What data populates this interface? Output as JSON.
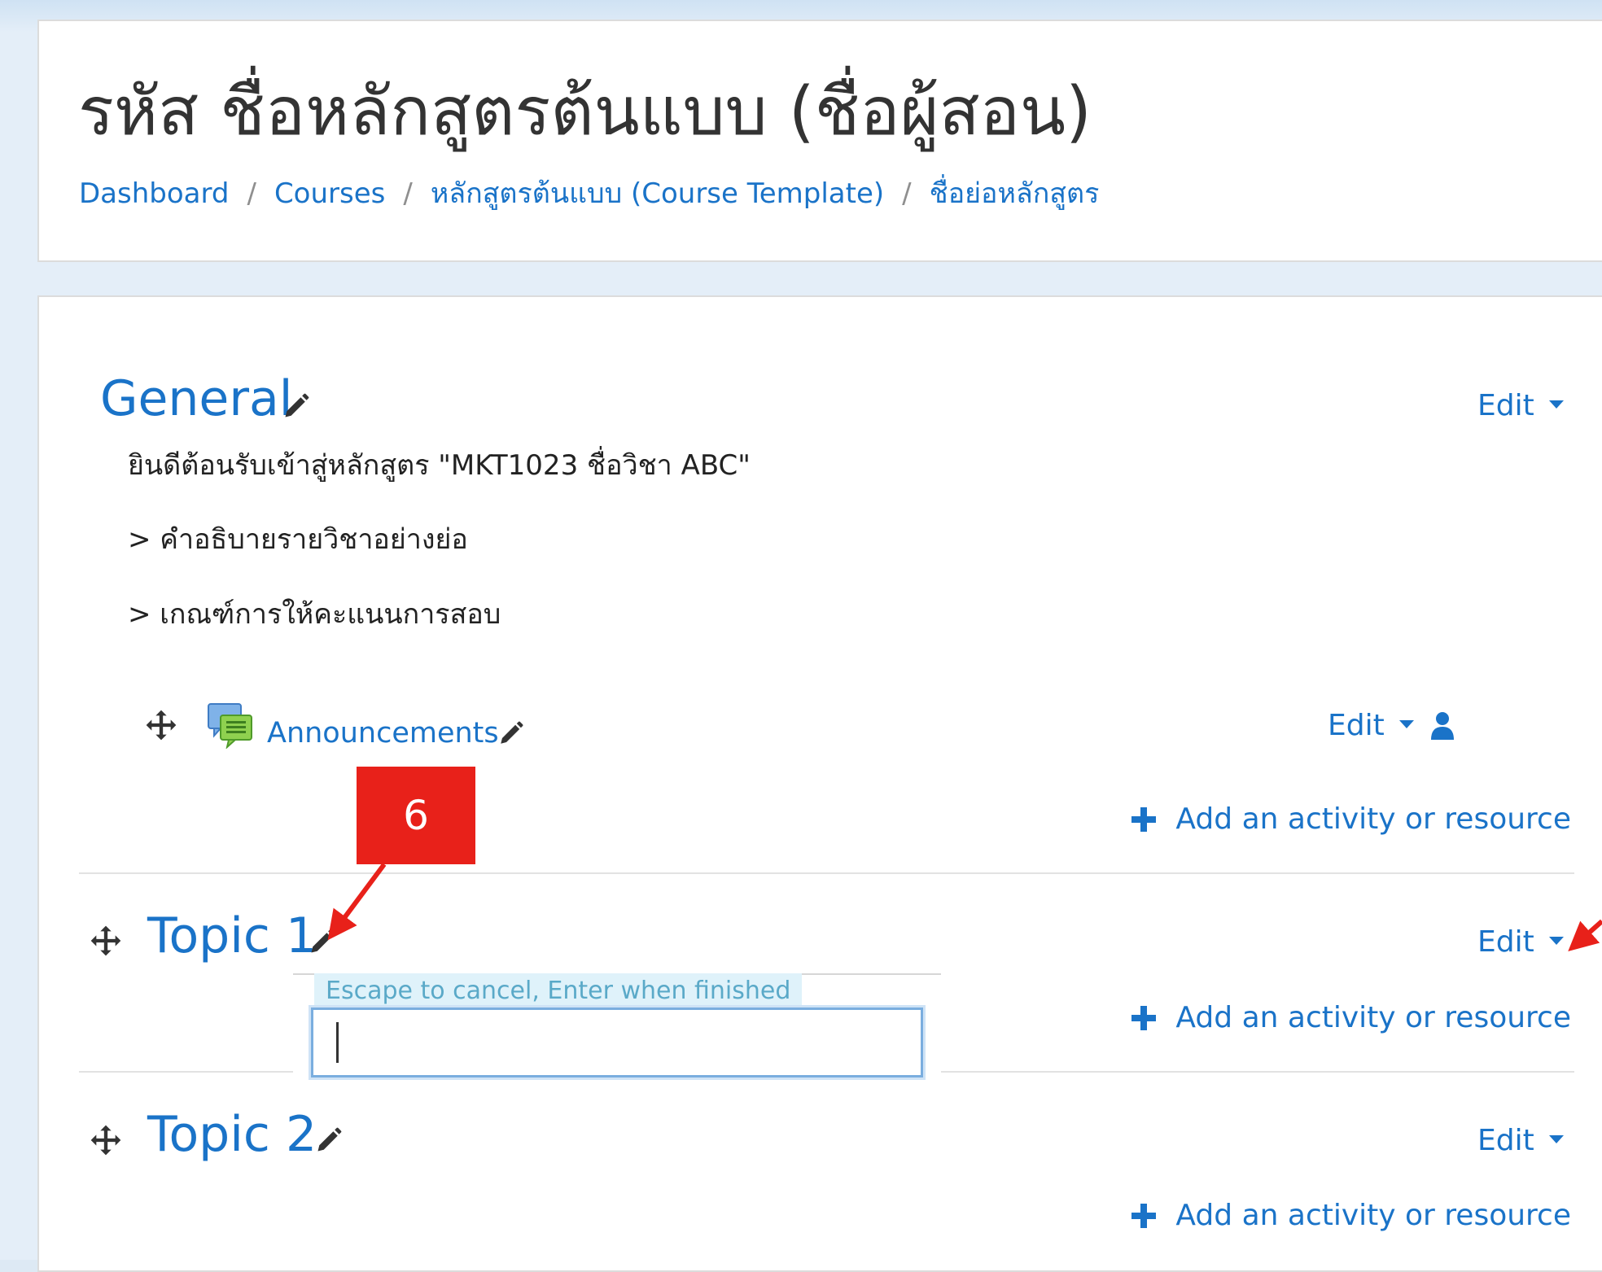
{
  "page": {
    "title": "รหัส ชื่อหลักสูตรต้นแบบ (ชื่อผู้สอน)"
  },
  "breadcrumb": {
    "items": [
      {
        "label": "Dashboard"
      },
      {
        "label": "Courses"
      },
      {
        "label": "หลักสูตรต้นแบบ (Course Template)"
      },
      {
        "label": "ชื่อย่อหลักสูตร"
      }
    ],
    "separator": "/"
  },
  "sections": [
    {
      "title": "General",
      "edit_label": "Edit",
      "summary": [
        "ยินดีต้อนรับเข้าสู่หลักสูตร \"MKT1023 ชื่อวิชา ABC\"",
        "> คำอธิบายรายวิชาอย่างย่อ",
        "> เกณฑ์การให้คะแนนการสอบ"
      ],
      "activities": [
        {
          "name": "Announcements",
          "icon": "forum-icon",
          "edit_label": "Edit"
        }
      ],
      "add_activity_label": "Add an activity or resource"
    },
    {
      "title": "Topic 1",
      "edit_label": "Edit",
      "inline_edit": {
        "help_text": "Escape to cancel, Enter when finished",
        "value": ""
      },
      "add_activity_label": "Add an activity or resource"
    },
    {
      "title": "Topic 2",
      "edit_label": "Edit",
      "add_activity_label": "Add an activity or resource"
    }
  ],
  "annotation": {
    "step_number": "6",
    "color": "#e8211a"
  },
  "colors": {
    "link": "#1a73c8",
    "text": "#333333",
    "background": "#dde9f4"
  }
}
